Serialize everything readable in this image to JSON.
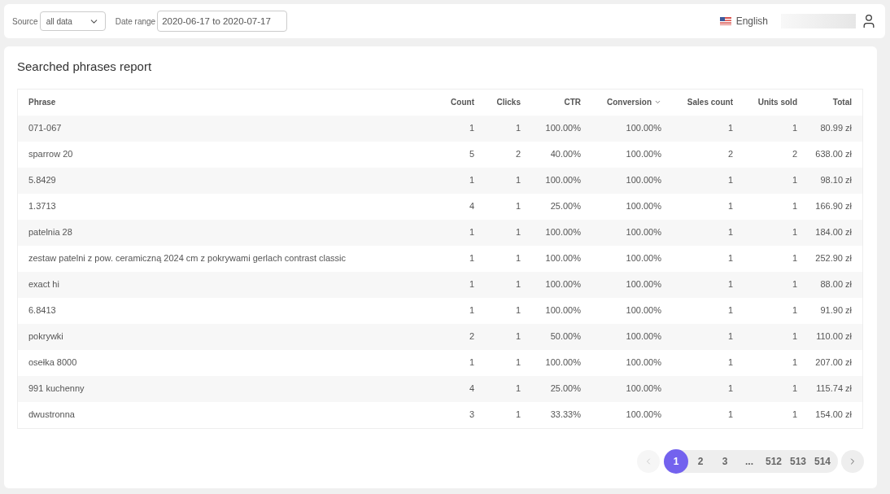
{
  "filters": {
    "source": {
      "label": "Source",
      "value": "all data"
    },
    "date_range": {
      "label": "Date range",
      "value": "2020-06-17 to 2020-07-17"
    }
  },
  "language": "English",
  "report": {
    "title": "Searched phrases report",
    "columns": [
      {
        "label": "Phrase",
        "sorted": false
      },
      {
        "label": "Count",
        "sorted": false
      },
      {
        "label": "Clicks",
        "sorted": false
      },
      {
        "label": "CTR",
        "sorted": false
      },
      {
        "label": "Conversion",
        "sorted": true
      },
      {
        "label": "Sales count",
        "sorted": false
      },
      {
        "label": "Units sold",
        "sorted": false
      },
      {
        "label": "Total",
        "sorted": false
      }
    ],
    "rows": [
      [
        "071-067",
        "1",
        "1",
        "100.00%",
        "100.00%",
        "1",
        "1",
        "80.99 zł"
      ],
      [
        "sparrow 20",
        "5",
        "2",
        "40.00%",
        "100.00%",
        "2",
        "2",
        "638.00 zł"
      ],
      [
        "5.8429",
        "1",
        "1",
        "100.00%",
        "100.00%",
        "1",
        "1",
        "98.10 zł"
      ],
      [
        "1.3713",
        "4",
        "1",
        "25.00%",
        "100.00%",
        "1",
        "1",
        "166.90 zł"
      ],
      [
        "patelnia 28",
        "1",
        "1",
        "100.00%",
        "100.00%",
        "1",
        "1",
        "184.00 zł"
      ],
      [
        "zestaw patelni z pow. ceramiczną 2024 cm z pokrywami gerlach contrast classic",
        "1",
        "1",
        "100.00%",
        "100.00%",
        "1",
        "1",
        "252.90 zł"
      ],
      [
        "exact hi",
        "1",
        "1",
        "100.00%",
        "100.00%",
        "1",
        "1",
        "88.00 zł"
      ],
      [
        "6.8413",
        "1",
        "1",
        "100.00%",
        "100.00%",
        "1",
        "1",
        "91.90 zł"
      ],
      [
        "pokrywki",
        "2",
        "1",
        "50.00%",
        "100.00%",
        "1",
        "1",
        "110.00 zł"
      ],
      [
        "osełka 8000",
        "1",
        "1",
        "100.00%",
        "100.00%",
        "1",
        "1",
        "207.00 zł"
      ],
      [
        "991 kuchenny",
        "4",
        "1",
        "25.00%",
        "100.00%",
        "1",
        "1",
        "115.74 zł"
      ],
      [
        "dwustronna",
        "3",
        "1",
        "33.33%",
        "100.00%",
        "1",
        "1",
        "154.00 zł"
      ]
    ]
  },
  "pagination": {
    "prev_disabled": true,
    "next_disabled": false,
    "pages": [
      {
        "label": "1",
        "selected": true
      },
      {
        "label": "2",
        "selected": false
      },
      {
        "label": "3",
        "selected": false
      },
      {
        "label": "...",
        "selected": false
      },
      {
        "label": "512",
        "selected": false
      },
      {
        "label": "513",
        "selected": false
      },
      {
        "label": "514",
        "selected": false
      }
    ]
  }
}
